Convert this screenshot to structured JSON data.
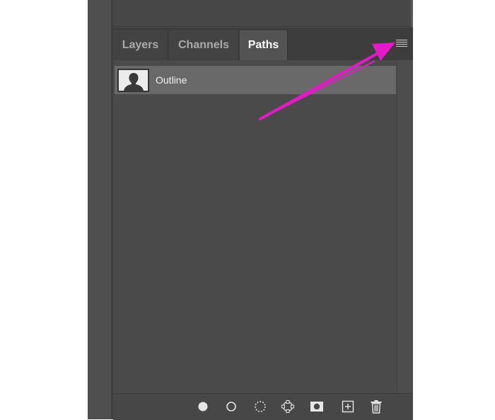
{
  "panel": {
    "tabs": [
      {
        "label": "Layers",
        "active": false
      },
      {
        "label": "Channels",
        "active": false
      },
      {
        "label": "Paths",
        "active": true
      }
    ],
    "menu_icon": "hamburger-menu-icon"
  },
  "paths": [
    {
      "name": "Outline",
      "thumbnail_icon": "silhouette-icon",
      "selected": true
    }
  ],
  "footer_tools": [
    {
      "icon": "fill-path-icon"
    },
    {
      "icon": "stroke-path-icon"
    },
    {
      "icon": "load-path-as-selection-icon"
    },
    {
      "icon": "make-work-path-icon"
    },
    {
      "icon": "add-mask-icon"
    },
    {
      "icon": "create-new-path-icon"
    },
    {
      "icon": "delete-path-icon"
    }
  ],
  "colors": {
    "panel_bg": "#535353",
    "row_selected": "#696969",
    "annotation_arrow": "#e619c8"
  }
}
